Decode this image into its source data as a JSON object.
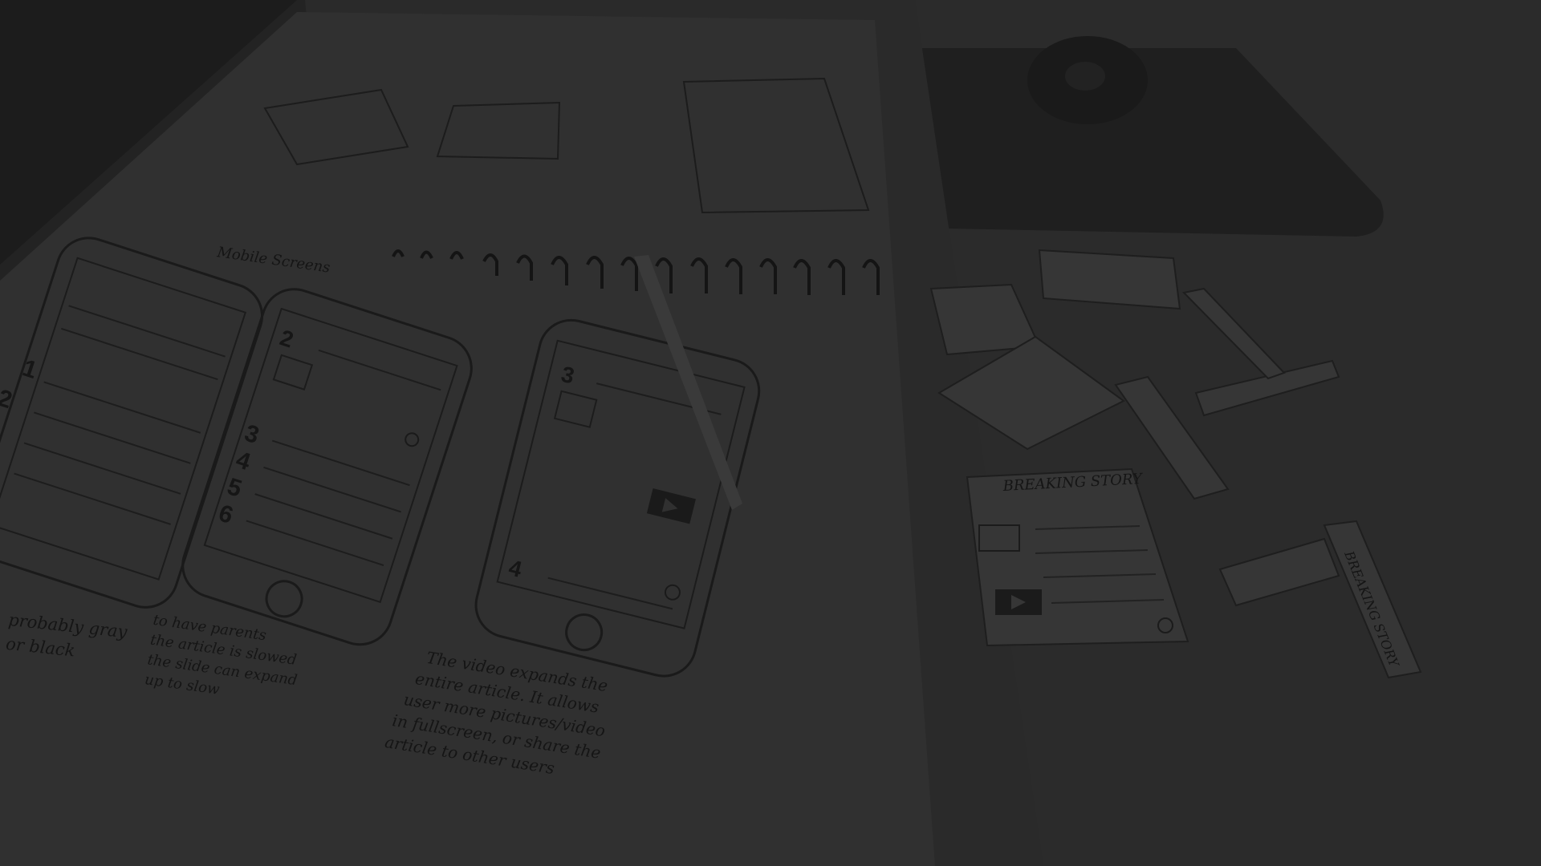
{
  "photo": {
    "colors": {
      "background": "#232323",
      "paper": "#303030",
      "ink": "#151515"
    },
    "sketch_labels": {
      "scene_name": "Mobile Screens",
      "numbers": [
        "1",
        "2",
        "2",
        "3",
        "4",
        "5",
        "6",
        "3",
        "4"
      ],
      "card_headline": "BREAKING STORY",
      "strip_label": "BREAKING STORY"
    },
    "notes": {
      "note_a": [
        "probably gray",
        "or black"
      ],
      "note_b": [
        "to have parents",
        "the article is slowed",
        "the slide can expand",
        "up to slow"
      ],
      "note_c": [
        "The video expands the",
        "entire article. It allows",
        "user more pictures/video",
        "in fullscreen, or share the",
        "article to other users"
      ]
    }
  }
}
